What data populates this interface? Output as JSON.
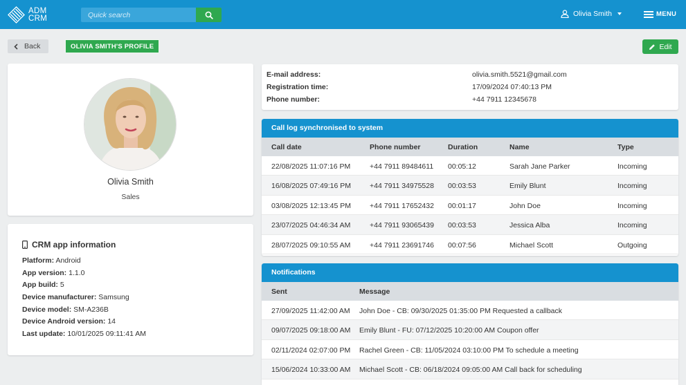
{
  "brand": {
    "line1": "ADM",
    "line2": "CRM"
  },
  "search": {
    "placeholder": "Quick search"
  },
  "user": {
    "name": "Olivia Smith"
  },
  "menu": {
    "label": "MENU"
  },
  "actions": {
    "back": "Back",
    "profile_tag": "OLIVIA SMITH'S PROFILE",
    "edit": "Edit"
  },
  "profile": {
    "name": "Olivia Smith",
    "role": "Sales"
  },
  "app_info": {
    "title": "CRM app information",
    "rows": [
      {
        "key": "Platform:",
        "value": "Android"
      },
      {
        "key": "App version:",
        "value": "1.1.0"
      },
      {
        "key": "App build:",
        "value": "5"
      },
      {
        "key": "Device manufacturer:",
        "value": "Samsung"
      },
      {
        "key": "Device model:",
        "value": "SM-A236B"
      },
      {
        "key": "Device Android version:",
        "value": "14"
      },
      {
        "key": "Last update:",
        "value": "10/01/2025 09:11:41 AM"
      }
    ]
  },
  "contact": [
    {
      "key": "E-mail address:",
      "value": "olivia.smith.5521@gmail.com"
    },
    {
      "key": "Registration time:",
      "value": "17/09/2024 07:40:13 PM"
    },
    {
      "key": "Phone number:",
      "value": "+44 7911 12345678"
    }
  ],
  "call_log": {
    "title": "Call log synchronised to system",
    "columns": [
      "Call date",
      "Phone number",
      "Duration",
      "Name",
      "Type"
    ],
    "rows": [
      [
        "22/08/2025 11:07:16 PM",
        "+44 7911 89484611",
        "00:05:12",
        "Sarah Jane Parker",
        "Incoming"
      ],
      [
        "16/08/2025 07:49:16 PM",
        "+44 7911 34975528",
        "00:03:53",
        "Emily Blunt",
        "Incoming"
      ],
      [
        "03/08/2025 12:13:45 PM",
        "+44 7911 17652432",
        "00:01:17",
        "John Doe",
        "Incoming"
      ],
      [
        "23/07/2025 04:46:34 AM",
        "+44 7911 93065439",
        "00:03:53",
        "Jessica Alba",
        "Incoming"
      ],
      [
        "28/07/2025 09:10:55 AM",
        "+44 7911 23691746",
        "00:07:56",
        "Michael Scott",
        "Outgoing"
      ]
    ]
  },
  "notifications": {
    "title": "Notifications",
    "columns": [
      "Sent",
      "Message"
    ],
    "rows": [
      [
        "27/09/2025 11:42:00 AM",
        "John Doe - CB: 09/30/2025 01:35:00 PM Requested a callback"
      ],
      [
        "09/07/2025 09:18:00 AM",
        "Emily Blunt - FU: 07/12/2025 10:20:00 AM Coupon offer"
      ],
      [
        "02/11/2024 02:07:00 PM",
        "Rachel Green - CB: 11/05/2024 03:10:00 PM To schedule a meeting"
      ],
      [
        "15/06/2024 10:33:00 AM",
        "Michael Scott - CB: 06/18/2024 09:05:00 AM Call back for scheduling"
      ]
    ]
  },
  "colors": {
    "primary": "#1592cf",
    "success": "#2fa84f",
    "header_row": "#d9dde1",
    "background": "#eceeef"
  }
}
